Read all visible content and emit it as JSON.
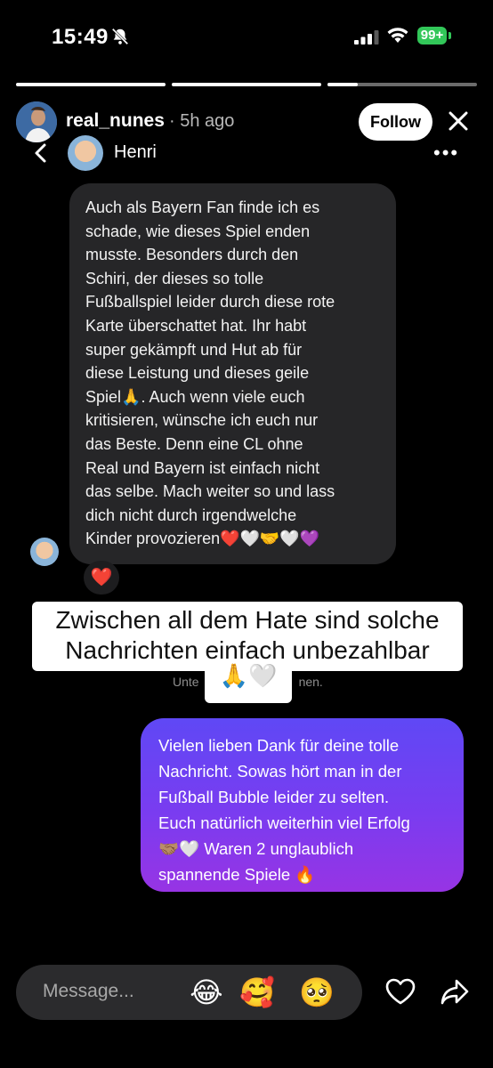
{
  "status_bar": {
    "time": "15:49",
    "battery": "99+"
  },
  "story": {
    "progress": [
      1,
      1,
      0.2
    ],
    "username": "real_nunes",
    "posted": "· 5h ago",
    "follow_label": "Follow",
    "sender_name": "Henri"
  },
  "incoming_message": {
    "text": "Auch als Bayern Fan finde ich es\nschade, wie dieses Spiel enden\nmusste. Besonders durch den\nSchiri, der dieses so tolle\nFußballspiel leider durch diese rote\nKarte überschattet hat. Ihr habt\nsuper gekämpft und Hut ab für\ndiese Leistung und dieses geile\nSpiel🙏. Auch wenn viele euch\nkritisieren, wünsche ich euch nur\ndas Beste. Denn eine CL ohne\nReal und Bayern ist einfach nicht\ndas selbe. Mach weiter so und lass\ndich nicht durch irgendwelche\nKinder provozieren❤️🤍🤝🤍💜",
    "reaction": "❤️"
  },
  "caption": {
    "text": "Zwischen all dem Hate sind solche Nachrichten einfach unbezahlbar",
    "emoji": "🙏🤍"
  },
  "hidden_note": {
    "left": "Unte",
    "right": "nen."
  },
  "outgoing_message": {
    "text": "Vielen lieben Dank für deine tolle\nNachricht. Sowas hört man in der\nFußball Bubble leider zu selten.\nEuch natürlich weiterhin viel Erfolg\n🤝🏽🤍 Waren 2 unglaublich\nspannende Spiele 🔥"
  },
  "composer": {
    "placeholder": "Message...",
    "quick_emojis": [
      "😂",
      "🥰",
      "🥺"
    ]
  },
  "icons": [
    "bell-slash-icon",
    "signal-icon",
    "wifi-icon",
    "battery-icon",
    "close-icon",
    "chevron-left-icon",
    "more-icon",
    "heart-icon",
    "share-icon"
  ]
}
